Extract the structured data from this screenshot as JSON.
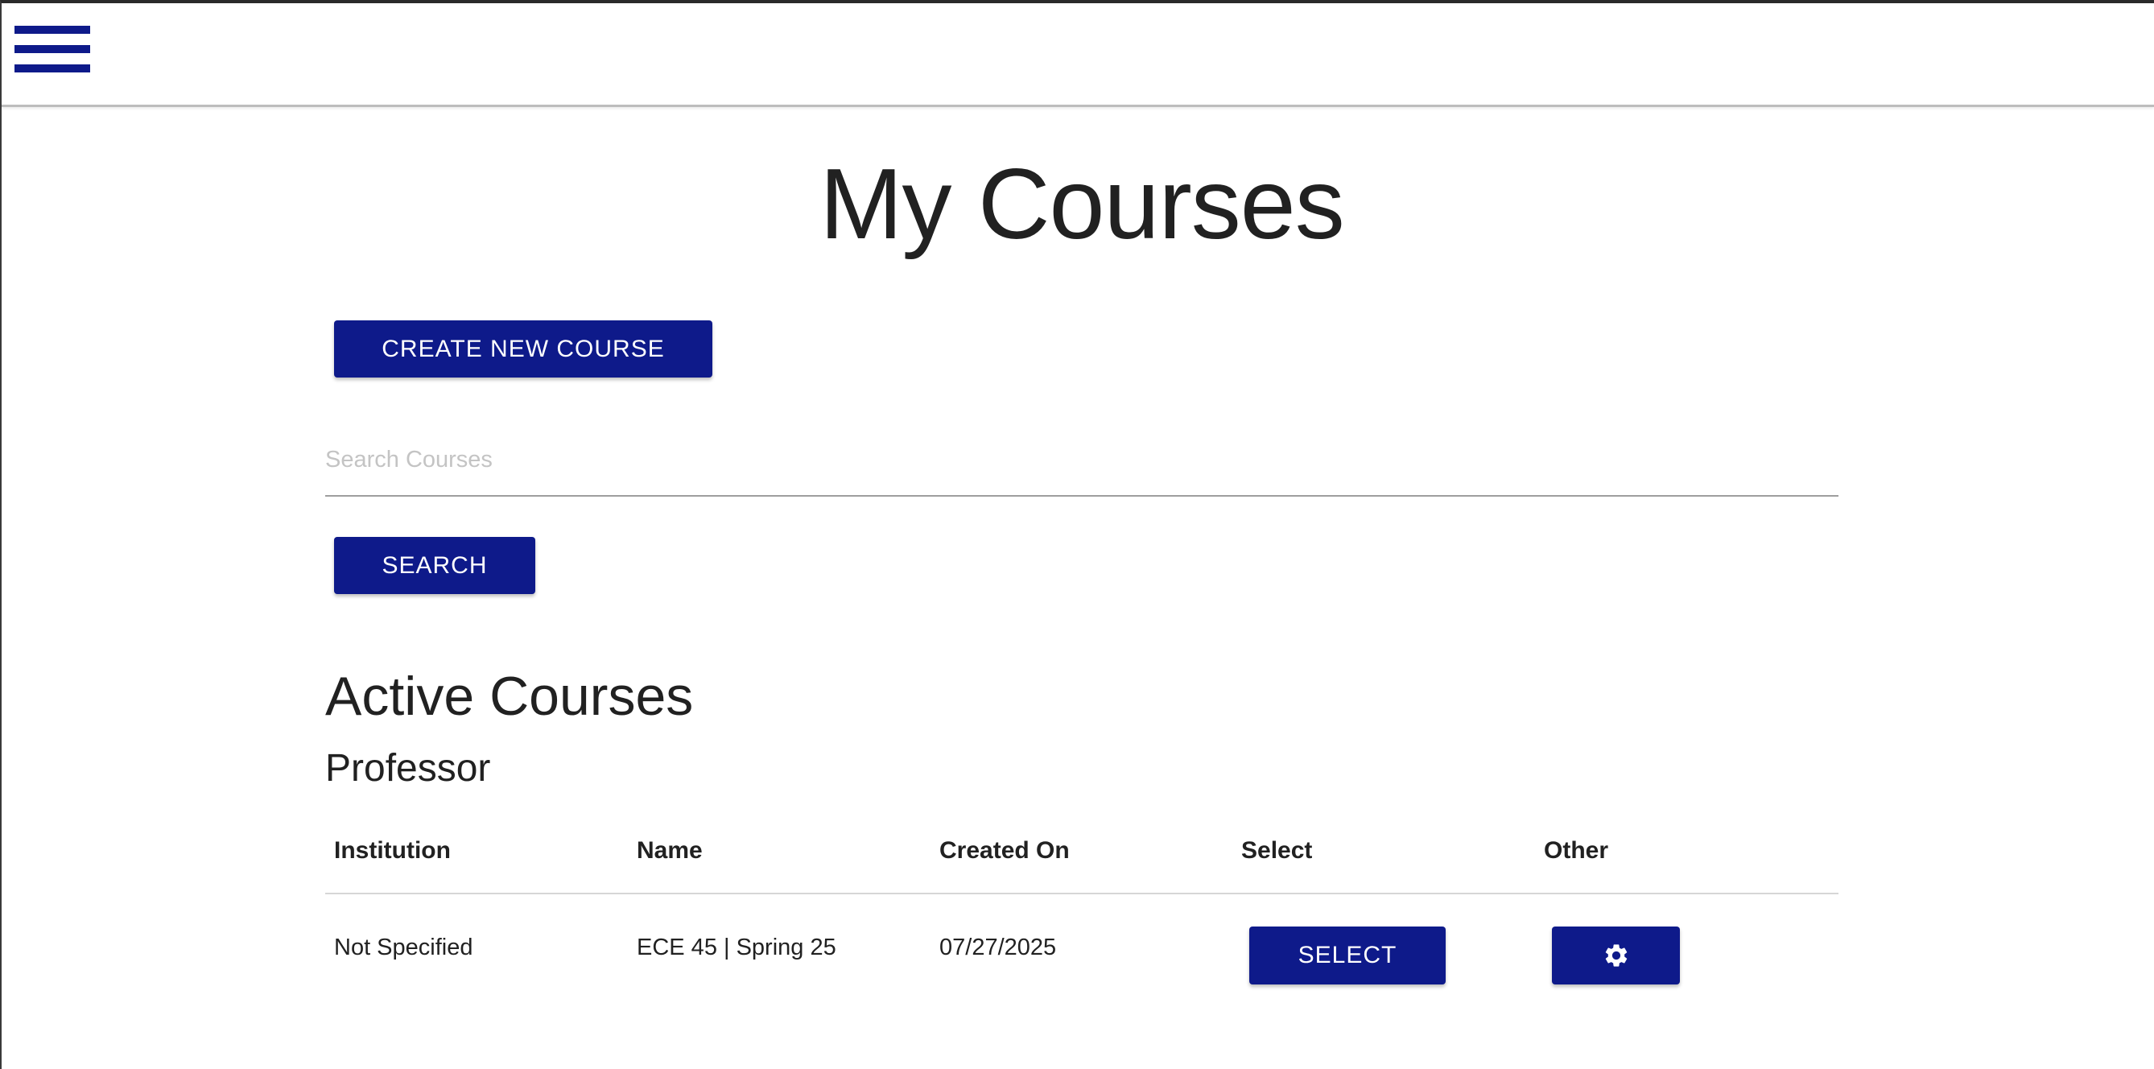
{
  "header": {
    "menu_icon": "hamburger-menu-icon"
  },
  "page": {
    "title": "My Courses",
    "create_button_label": "CREATE NEW COURSE",
    "search": {
      "placeholder": "Search Courses",
      "value": "",
      "button_label": "SEARCH"
    }
  },
  "active_courses": {
    "section_title": "Active Courses",
    "role_title": "Professor",
    "columns": [
      "Institution",
      "Name",
      "Created On",
      "Select",
      "Other"
    ],
    "rows": [
      {
        "institution": "Not Specified",
        "name": "ECE 45 | Spring 25",
        "created_on": "07/27/2025",
        "select_label": "SELECT",
        "other_icon": "gear-icon"
      }
    ]
  },
  "colors": {
    "primary": "#0e1a8a",
    "text": "#212121",
    "placeholder": "#c4c4c4",
    "divider": "#d6d6d6"
  }
}
